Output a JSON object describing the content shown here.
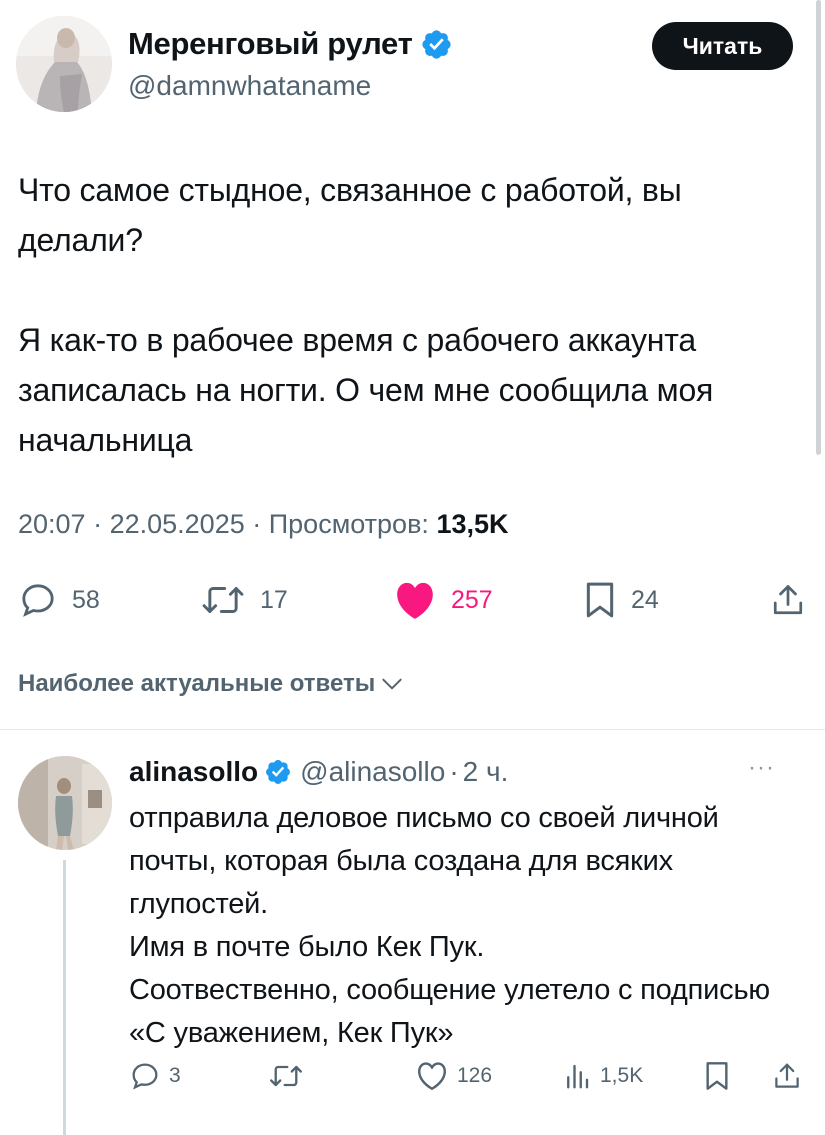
{
  "tweet": {
    "author_name": "Меренговый рулет",
    "handle": "@damnwhataname",
    "follow_label": "Читать",
    "text": "Что самое стыдное, связанное с работой, вы делали?\n\nЯ как-то в рабочее время с рабочего аккаунта записалась на ногти. О чем мне сообщила моя начальница",
    "time": "20:07",
    "date": "22.05.2025",
    "views_label": "Просмотров:",
    "views": "13,5K",
    "stats": {
      "replies": "58",
      "reposts": "17",
      "likes": "257",
      "bookmarks": "24"
    },
    "accent_like": "#f91880",
    "verified_color": "#1d9bf0"
  },
  "replies_sort_label": "Наиболее актуальные ответы",
  "reply": {
    "author_name": "alinasollo",
    "handle": "@alinasollo",
    "age": "2 ч.",
    "text": "отправила деловое письмо со своей личной почты, которая была создана для всяких глупостей.\nИмя в почте было Кек Пук.\nСоотвественно, сообщение улетело с подписью  «С уважением, Кек Пук»",
    "stats": {
      "replies": "3",
      "likes": "126",
      "views": "1,5K"
    }
  }
}
